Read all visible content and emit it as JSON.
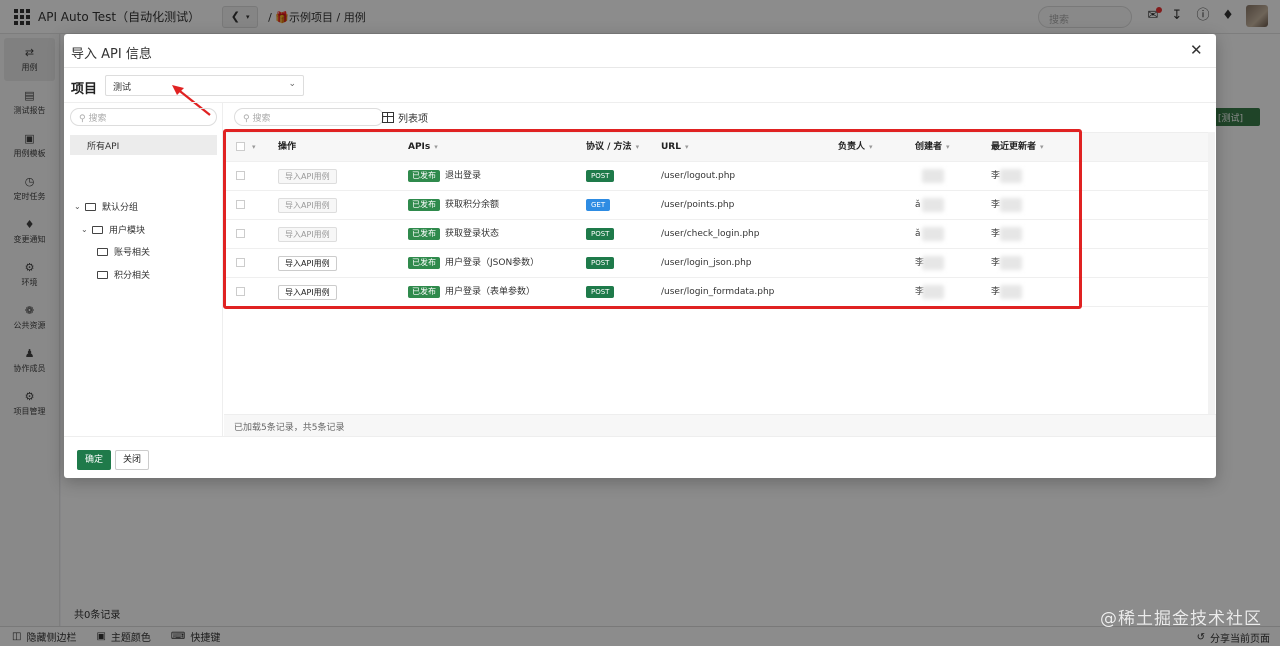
{
  "topbar": {
    "app_title": "API Auto Test（自动化测试）",
    "breadcrumb_sep": "/",
    "breadcrumb_project": "示例项目",
    "breadcrumb_page": "用例",
    "search_placeholder": "搜索"
  },
  "sidebar": {
    "items": [
      {
        "label": "用例",
        "icon": "swap-icon",
        "active": true
      },
      {
        "label": "测试报告",
        "icon": "report-icon"
      },
      {
        "label": "用例模板",
        "icon": "template-icon"
      },
      {
        "label": "定时任务",
        "icon": "clock-icon"
      },
      {
        "label": "变更通知",
        "icon": "bell-icon"
      },
      {
        "label": "环境",
        "icon": "environment-icon"
      },
      {
        "label": "公共资源",
        "icon": "gear-icon"
      },
      {
        "label": "协作成员",
        "icon": "user-icon"
      },
      {
        "label": "项目管理",
        "icon": "settings-icon"
      }
    ]
  },
  "page": {
    "green_button": "[测试]",
    "record_count": "共0条记录"
  },
  "bottombar": {
    "hide_sidebar": "隐藏侧边栏",
    "theme_color": "主题颜色",
    "shortcuts": "快捷键",
    "share_page": "分享当前页面"
  },
  "watermark": "@稀土掘金技术社区",
  "modal": {
    "title": "导入 API 信息",
    "project_label": "项目",
    "project_value": "测试",
    "tree_search_placeholder": "搜索",
    "all_api": "所有API",
    "tree": [
      {
        "label": "默认分组",
        "level": 0,
        "expanded": true
      },
      {
        "label": "用户模块",
        "level": 1,
        "expanded": true
      },
      {
        "label": "账号相关",
        "level": 2
      },
      {
        "label": "积分相关",
        "level": 2
      }
    ],
    "grid_search_placeholder": "搜索",
    "column_button": "列表项",
    "columns": {
      "action": "操作",
      "apis": "APIs",
      "protocol": "协议 / 方法",
      "url": "URL",
      "owner": "负责人",
      "creator": "创建者",
      "updater": "最近更新者"
    },
    "rows": [
      {
        "action": "导入API用例",
        "enabled": false,
        "status": "已发布",
        "name": "退出登录",
        "method": "POST",
        "url": "/user/logout.php",
        "creator": "",
        "updater": "李"
      },
      {
        "action": "导入API用例",
        "enabled": false,
        "status": "已发布",
        "name": "获取积分余额",
        "method": "GET",
        "url": "/user/points.php",
        "creator": "ǎ",
        "updater": "李"
      },
      {
        "action": "导入API用例",
        "enabled": false,
        "status": "已发布",
        "name": "获取登录状态",
        "method": "POST",
        "url": "/user/check_login.php",
        "creator": "ǎ",
        "updater": "李"
      },
      {
        "action": "导入API用例",
        "enabled": true,
        "status": "已发布",
        "name": "用户登录（JSON参数）",
        "method": "POST",
        "url": "/user/login_json.php",
        "creator": "李",
        "updater": "李"
      },
      {
        "action": "导入API用例",
        "enabled": true,
        "status": "已发布",
        "name": "用户登录（表单参数）",
        "method": "POST",
        "url": "/user/login_formdata.php",
        "creator": "李",
        "updater": "李"
      }
    ],
    "footer_status": "已加载5条记录，共5条记录",
    "ok_button": "确定",
    "close_button": "关闭"
  },
  "colors": {
    "accent_green": "#1f7a4a",
    "post": "#1e7a4a",
    "get": "#2e8ce3",
    "highlight_red": "#e02222"
  }
}
